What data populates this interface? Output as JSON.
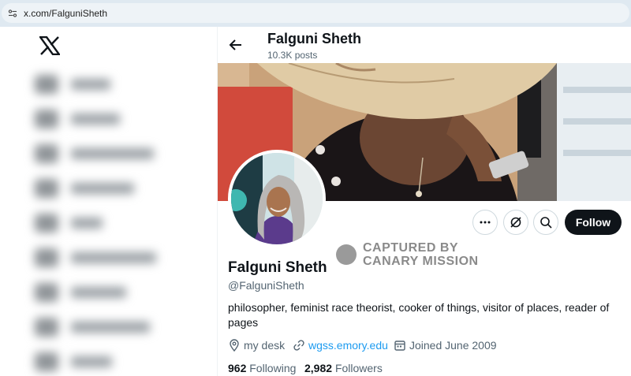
{
  "browser": {
    "url": "x.com/FalguniSheth"
  },
  "sidebar": {
    "logo_icon": "x-logo-icon",
    "items_blurred_count_note": "",
    "items": [
      {
        "icon": "home-icon"
      },
      {
        "icon": "explore-icon"
      },
      {
        "icon": "notifications-icon"
      },
      {
        "icon": "messages-icon"
      },
      {
        "icon": "grok-icon"
      },
      {
        "icon": "communities-icon"
      },
      {
        "icon": "premium-icon"
      },
      {
        "icon": "verified-orgs-icon"
      },
      {
        "icon": "profile-icon"
      }
    ]
  },
  "header": {
    "name": "Falguni Sheth",
    "posts_count": "10.3K posts"
  },
  "actions": {
    "more_icon": "more-icon",
    "grok_icon": "grok-icon",
    "search_icon": "search-icon",
    "follow_label": "Follow"
  },
  "watermark": {
    "line1": "CAPTURED BY",
    "line2": "CANARY MISSION"
  },
  "profile": {
    "display_name": "Falguni Sheth",
    "handle": "@FalguniSheth",
    "bio": "philosopher, feminist race theorist, cooker of things, visitor of places, reader of pages",
    "location": "my desk",
    "website": "wgss.emory.edu",
    "joined": "Joined June 2009",
    "following_count": "962",
    "following_label": "Following",
    "followers_count": "2,982",
    "followers_label": "Followers"
  },
  "colors": {
    "accent_link": "#1d9bf0",
    "follow_button_bg": "#0f1419",
    "secondary_text": "#536471"
  }
}
